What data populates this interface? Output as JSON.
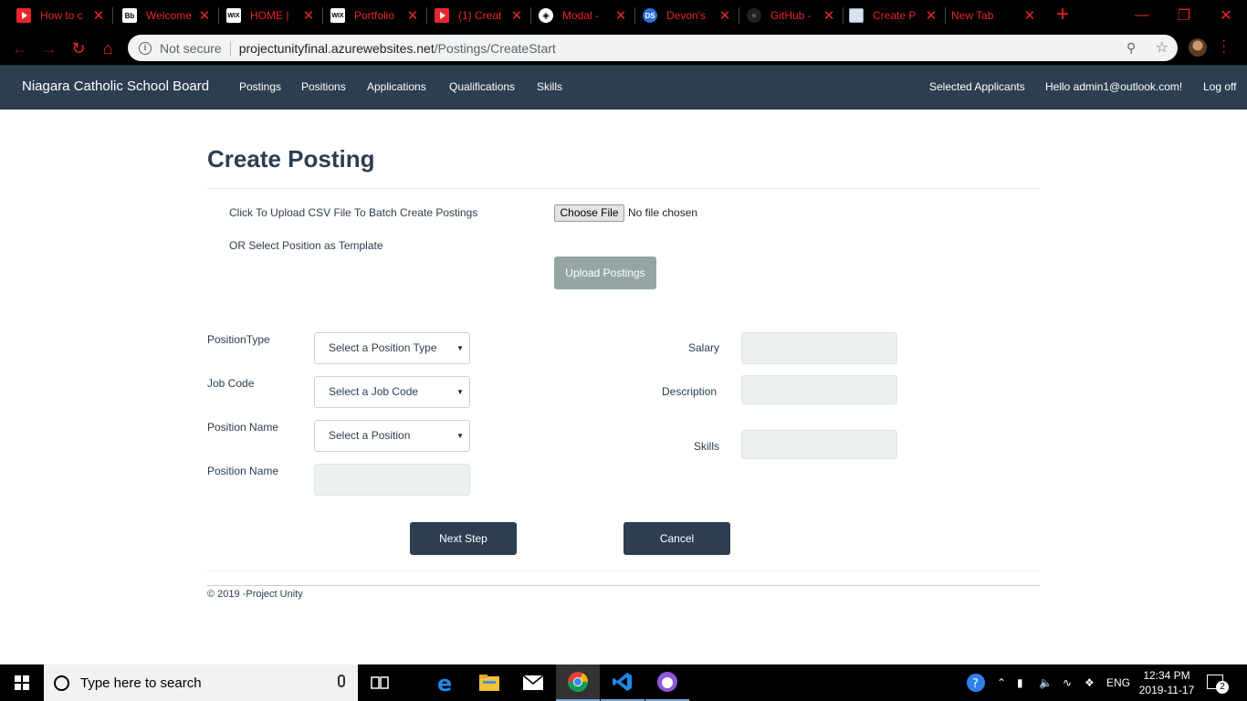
{
  "browser": {
    "tabs": [
      {
        "title": "How to c",
        "icon": "youtube-icon"
      },
      {
        "title": "Welcome",
        "icon": "blackboard-icon"
      },
      {
        "title": "HOME |",
        "icon": "wix-icon"
      },
      {
        "title": "Portfolio",
        "icon": "wix-icon"
      },
      {
        "title": "(1) Creat",
        "icon": "youtube-icon"
      },
      {
        "title": "Modal -",
        "icon": "codepen-icon"
      },
      {
        "title": "Devon's",
        "icon": "ds-icon"
      },
      {
        "title": "GitHub -",
        "icon": "github-icon"
      },
      {
        "title": "Create P",
        "icon": "document-icon"
      },
      {
        "title": "New Tab",
        "icon": ""
      }
    ],
    "close_glyph": "✕",
    "new_tab_glyph": "+",
    "favicon_text": {
      "bb": "Bb",
      "wix": "WIX",
      "cp": "◈",
      "ds": "DS",
      "gh": "●"
    },
    "address": {
      "security_label": "Not secure",
      "host": "projectunityfinal.azurewebsites.net",
      "path": "/Postings/CreateStart"
    },
    "accent_color": "#e8262b"
  },
  "navbar": {
    "brand": "Niagara Catholic School Board",
    "links": [
      "Postings",
      "Positions",
      "Applications",
      "Qualifications",
      "Skills"
    ],
    "right_links": [
      "Selected Applicants",
      "Hello admin1@outlook.com!",
      "Log off"
    ],
    "bg_color": "#2c3e50"
  },
  "form": {
    "title": "Create Posting",
    "csv_label": "Click To Upload CSV File To Batch Create Postings",
    "template_label": "OR Select Position as Template",
    "choose_file": "Choose File",
    "no_file": "No file chosen",
    "upload_button": "Upload Postings",
    "left_fields": [
      {
        "label": "PositionType",
        "placeholder": "Select a Position Type"
      },
      {
        "label": "Job Code",
        "placeholder": "Select a Job Code"
      },
      {
        "label": "Position Name",
        "placeholder": "Select a Position"
      },
      {
        "label": "Position Name",
        "value": ""
      }
    ],
    "right_fields": [
      {
        "label": "Salary",
        "value": ""
      },
      {
        "label": "Description",
        "value": ""
      },
      {
        "label": "Skills",
        "value": ""
      }
    ],
    "next_button": "Next Step",
    "cancel_button": "Cancel"
  },
  "footer": {
    "text": "© 2019 -Project Unity"
  },
  "taskbar": {
    "search_placeholder": "Type here to search",
    "language": "ENG",
    "time": "12:34 PM",
    "date": "2019-11-17",
    "notification_count": "2"
  }
}
